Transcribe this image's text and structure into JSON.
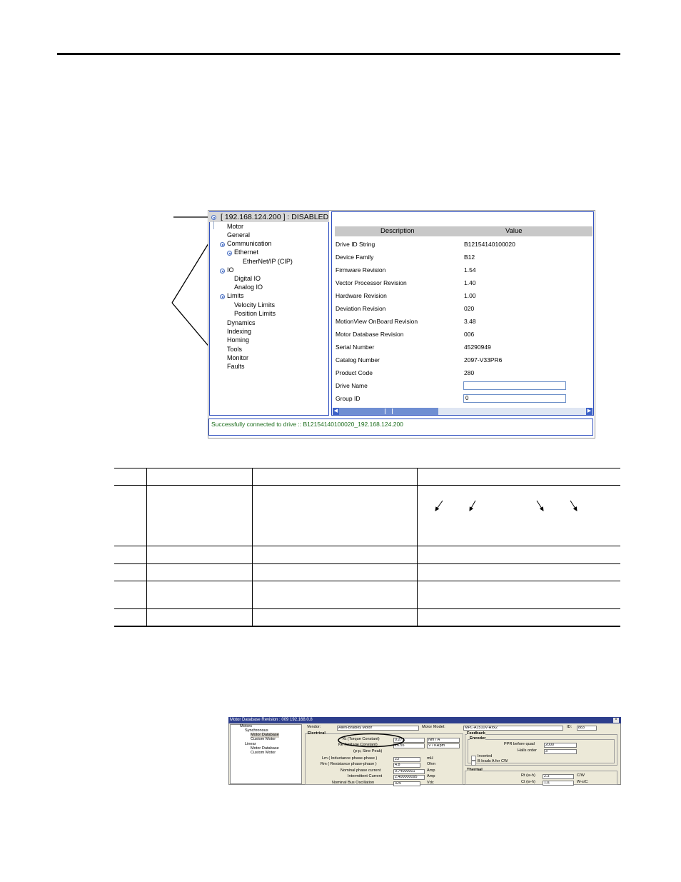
{
  "tree": {
    "header": "[ 192.168.124.200 ]  : DISABLED",
    "nodes": {
      "motor": "Motor",
      "general": "General",
      "communication": "Communication",
      "ethernet": "Ethernet",
      "ethernetip": "EtherNet/IP (CIP)",
      "io": "IO",
      "digital_io": "Digital IO",
      "analog_io": "Analog IO",
      "limits": "Limits",
      "velocity_limits": "Velocity Limits",
      "position_limits": "Position Limits",
      "dynamics": "Dynamics",
      "indexing": "Indexing",
      "homing": "Homing",
      "tools": "Tools",
      "monitor": "Monitor",
      "faults": "Faults"
    }
  },
  "grid": {
    "headers": {
      "description": "Description",
      "value": "Value"
    },
    "rows": [
      {
        "description": "Drive ID String",
        "value": "B12154140100020"
      },
      {
        "description": "Device Family",
        "value": "B12"
      },
      {
        "description": "Firmware Revision",
        "value": "1.54"
      },
      {
        "description": "Vector Processor Revision",
        "value": "1.40"
      },
      {
        "description": "Hardware Revision",
        "value": "1.00"
      },
      {
        "description": "Deviation Revision",
        "value": "020"
      },
      {
        "description": "MotionView OnBoard Revision",
        "value": "3.48"
      },
      {
        "description": "Motor Database Revision",
        "value": "006"
      },
      {
        "description": "Serial Number",
        "value": "45290949"
      },
      {
        "description": "Catalog Number",
        "value": "2097-V33PR6"
      },
      {
        "description": "Product Code",
        "value": "280"
      }
    ],
    "drive_name": {
      "label": "Drive Name",
      "value": ""
    },
    "group_id": {
      "label": "Group ID",
      "value": "0"
    }
  },
  "status": "Successfully connected to drive :: B12154140100020_192.168.124.200",
  "motor_db": {
    "title": "Motor Database    Revision :  009    192.168.0.8",
    "close": "×",
    "tree": {
      "motors": "Motors",
      "synchronous": "Synchronous",
      "motor_database_1": "Motor Database",
      "custom_motor_1": "Custom Motor",
      "linear": "Linear",
      "motor_database_2": "Motor Database",
      "custom_motor_2": "Custom Motor"
    },
    "vendor_label": "Vendor:",
    "vendor_value": "Allen-Bradley Motor",
    "model_label": "Motor Model:",
    "model_value": "MPL-A1510V-Hxx2",
    "id_label": "ID:",
    "id_value": "883",
    "electrical_group": "Electrical",
    "electrical": [
      {
        "label": "Kt (Torque Constant)",
        "value": "0.273",
        "unit": "Nm / A"
      },
      {
        "label": "Ke (Voltage Constant)",
        "value": "16.55",
        "unit": "V / KRpm"
      },
      {
        "label": "(p-p, Sine Peak)",
        "value": "",
        "unit": ""
      },
      {
        "label": "Lm ( Inductance phase-phase )",
        "value": "23",
        "unit": "mH"
      },
      {
        "label": "Rm ( Resistance phase-phase )",
        "value": "4.8",
        "unit": "Ohm"
      },
      {
        "label": "Nominal phase current",
        "value": "0.74000001",
        "unit": "Amp"
      },
      {
        "label": "Intermittent Current",
        "value": "2.400000095",
        "unit": "Amp"
      },
      {
        "label": "Nominal Bus Oscillation",
        "value": "325",
        "unit": "Vdc"
      }
    ],
    "feedback_group": "Feedback",
    "encoder_group": "Encoder",
    "ppr_label": "PPR before quad",
    "ppr_value": "2000",
    "halls_label": "Halls order",
    "halls_value": "3",
    "inverted_label": "Inverted",
    "b_leads_label": "B leads A for CW",
    "thermal_group": "Thermal",
    "rt_label": "Rt (w-h)",
    "rt_value": "2.3",
    "rt_unit": "C/W",
    "ct_label": "Ct (w-h)",
    "ct_value": "111",
    "ct_unit": "W-s/C"
  }
}
